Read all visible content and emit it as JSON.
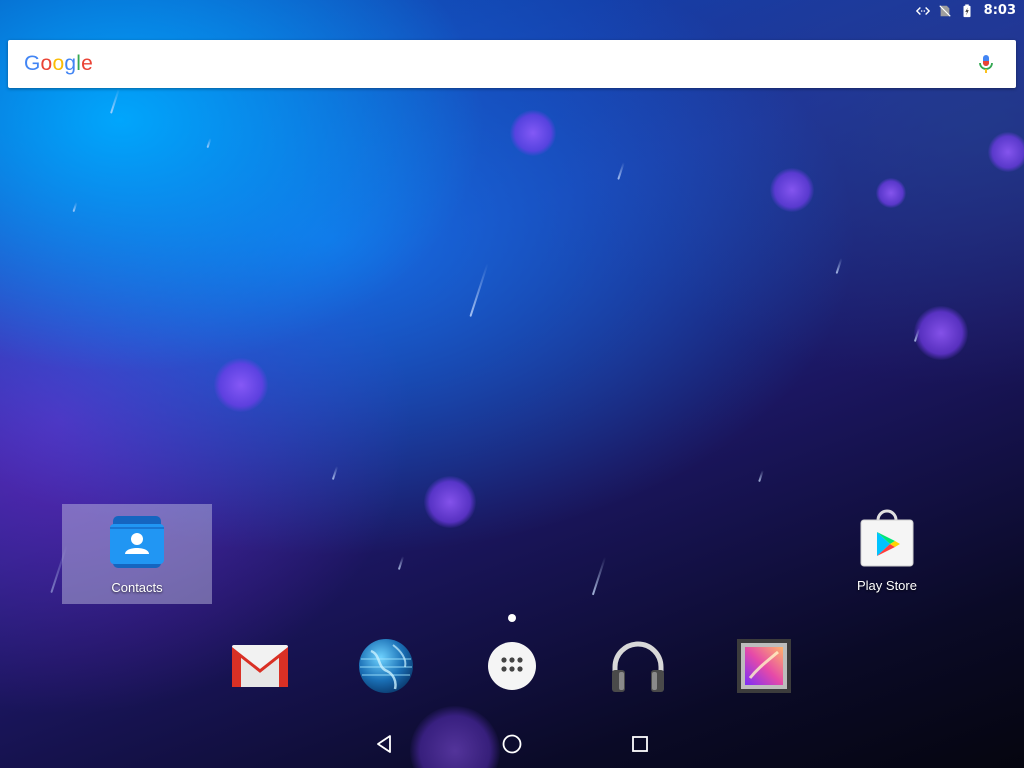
{
  "status_bar": {
    "time": "8:03",
    "icons": [
      "data-transfer-icon",
      "no-sim-icon",
      "battery-charging-icon"
    ]
  },
  "search_bar": {
    "logo_letters": [
      {
        "char": "G",
        "color": "#4285F4"
      },
      {
        "char": "o",
        "color": "#EA4335"
      },
      {
        "char": "o",
        "color": "#FBBC05"
      },
      {
        "char": "g",
        "color": "#4285F4"
      },
      {
        "char": "l",
        "color": "#34A853"
      },
      {
        "char": "e",
        "color": "#EA4335"
      }
    ],
    "mic_icon": "mic-icon"
  },
  "desktop": {
    "shortcuts": [
      {
        "label": "Contacts",
        "icon": "contacts-icon"
      },
      {
        "label": "Play Store",
        "icon": "play-store-icon"
      }
    ]
  },
  "hotseat": {
    "apps": [
      "gmail-icon",
      "browser-globe-icon",
      "app-drawer-icon",
      "music-headphones-icon",
      "gallery-icon"
    ]
  },
  "nav_bar": {
    "buttons": [
      "back-icon",
      "home-icon",
      "recents-icon"
    ]
  },
  "colors": {
    "google_blue": "#4285F4",
    "google_red": "#EA4335",
    "google_yellow": "#FBBC05",
    "google_green": "#34A853",
    "contacts_blue": "#1E88E5",
    "play_green": "#00C853"
  }
}
